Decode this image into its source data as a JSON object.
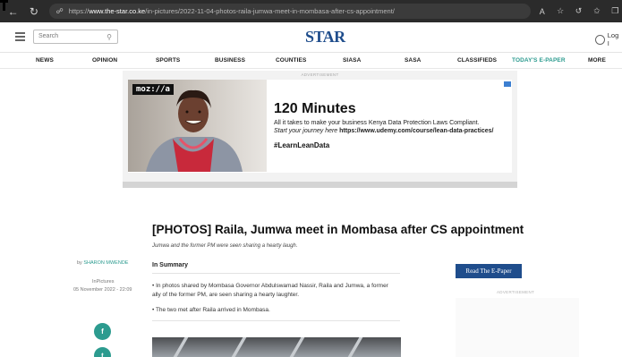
{
  "browser": {
    "url_prefix": "https://",
    "url_host": "www.the-star.co.ke",
    "url_path": "/in-pictures/2022-11-04-photos-raila-jumwa-meet-in-mombasa-after-cs-appointment/"
  },
  "header": {
    "search_placeholder": "Search",
    "logo_text": "STAR",
    "login_label": "Log I"
  },
  "nav": {
    "items": [
      "NEWS",
      "OPINION",
      "SPORTS",
      "BUSINESS",
      "COUNTIES",
      "SIASA",
      "SASA",
      "CLASSIFIEDS",
      "TODAY'S E-PAPER",
      "MORE"
    ]
  },
  "ad": {
    "label": "ADVERTISEMENT",
    "brand": "moz://a",
    "title": "120 Minutes",
    "line1": "All it takes to make your business Kenya Data Protection Laws Compliant.",
    "line2_prefix": "Start your journey here ",
    "line2_link": "https://www.udemy.com/course/lean-data-practices/",
    "hashtag": "#LearnLeanData"
  },
  "article": {
    "headline": "[PHOTOS] Raila, Jumwa meet in Mombasa after CS appointment",
    "subhead": "Jumwa and the former PM were seen sharing a hearty laugh.",
    "byline_prefix": "by ",
    "author": "SHARON MWENDE",
    "category": "InPictures",
    "date": "05 November 2022 - 22:09",
    "summary_heading": "In Summary",
    "bullets": [
      "• In photos shared by Mombasa Governor Abdulswamad Nassir, Raila and Jumwa, a former ally of the former PM, are seen sharing a hearty laughter.",
      "• The two met after Raila arrived in Mombasa."
    ]
  },
  "share": {
    "facebook_glyph": "f",
    "twitter_glyph": "t"
  },
  "rail": {
    "epaper_button": "Read The E-Paper",
    "ad_label": "ADVERTISEMENT"
  },
  "colors": {
    "brand_blue": "#1f4d8c",
    "accent_teal": "#2c9b8f",
    "chrome_dark": "#2b2b2b"
  }
}
